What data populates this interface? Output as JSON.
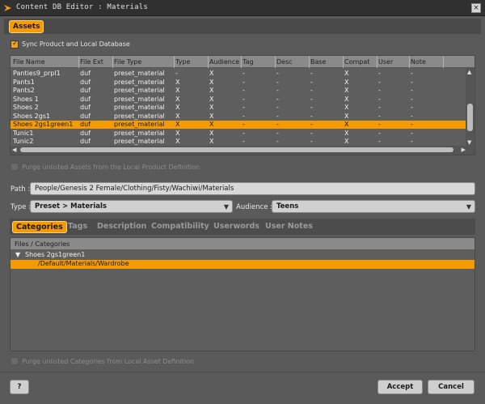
{
  "window": {
    "title": "Content DB Editor : Materials",
    "close_glyph": "×"
  },
  "assets_tab": "Assets",
  "sync": {
    "label": "Sync Product and Local Database",
    "checked": true
  },
  "table": {
    "columns": [
      "File Name",
      "File Ext",
      "File Type",
      "Type",
      "Audience",
      "Tag",
      "Desc",
      "Base",
      "Compat",
      "User",
      "Note"
    ],
    "rows": [
      [
        "Panties9_prpl1",
        "duf",
        "preset_material",
        "-",
        "X",
        "-",
        "-",
        "-",
        "X",
        "-",
        "-"
      ],
      [
        "Pants1",
        "duf",
        "preset_material",
        "X",
        "X",
        "-",
        "-",
        "-",
        "X",
        "-",
        "-"
      ],
      [
        "Pants2",
        "duf",
        "preset_material",
        "X",
        "X",
        "-",
        "-",
        "-",
        "X",
        "-",
        "-"
      ],
      [
        "Shoes 1",
        "duf",
        "preset_material",
        "X",
        "X",
        "-",
        "-",
        "-",
        "X",
        "-",
        "-"
      ],
      [
        "Shoes 2",
        "duf",
        "preset_material",
        "X",
        "X",
        "-",
        "-",
        "-",
        "X",
        "-",
        "-"
      ],
      [
        "Shoes 2gs1",
        "duf",
        "preset_material",
        "X",
        "X",
        "-",
        "-",
        "-",
        "X",
        "-",
        "-"
      ],
      [
        "Shoes 2gs1green1",
        "duf",
        "preset_material",
        "X",
        "X",
        "-",
        "-",
        "-",
        "X",
        "-",
        "-"
      ],
      [
        "Tunic1",
        "duf",
        "preset_material",
        "X",
        "X",
        "-",
        "-",
        "-",
        "X",
        "-",
        "-"
      ],
      [
        "Tunic2",
        "duf",
        "preset_material",
        "X",
        "X",
        "-",
        "-",
        "-",
        "X",
        "-",
        "-"
      ]
    ],
    "selected_row": 6
  },
  "purge_assets": {
    "label": "Purge unlisted Assets from the Local Product Definition",
    "checked": false
  },
  "path": {
    "label": "Path :",
    "value": "People/Genesis 2 Female/Clothing/Fisty/Wachiwi/Materials"
  },
  "type": {
    "label": "Type :",
    "value": "Preset > Materials"
  },
  "audience": {
    "label": "Audience :",
    "value": "Teens"
  },
  "subtabs": [
    "Categories",
    "Tags",
    "Description",
    "Compatibility",
    "Userwords",
    "User Notes"
  ],
  "files_categories": {
    "header": "Files / Categories",
    "tree": [
      {
        "label": "Shoes 2gs1green1",
        "expand_glyph": "▼"
      },
      {
        "label": "/Default/Materials/Wardrobe"
      }
    ]
  },
  "purge_categories": {
    "label": "Purge unlisted Categories from Local Asset Definition",
    "checked": false
  },
  "buttons": {
    "help": "?",
    "accept": "Accept",
    "cancel": "Cancel"
  },
  "colors": {
    "accent": "#f59b00",
    "background": "#5a5a5a"
  }
}
